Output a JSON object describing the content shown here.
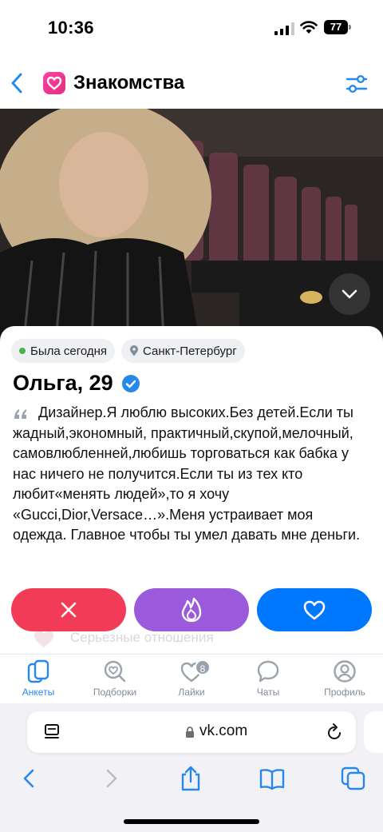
{
  "status_bar": {
    "time": "10:36",
    "battery": "77"
  },
  "header": {
    "title": "Знакомства",
    "back_icon": "chevron-left-icon",
    "filter_icon": "sliders-icon"
  },
  "profile": {
    "status_chip": "Была сегодня",
    "city_chip": "Санкт-Петербург",
    "name": "Ольга, 29",
    "verified": true,
    "bio": "Дизайнер.Я люблю высоких.Без детей.Если ты жадный,экономный, практичный,скупой,мелочный, самовлюбленней,любишь торговаться как бабка у нас ничего не получится.Если ты из тех кто любит«менять людей»,то я хочу «Gucci,Dior,Versace…».Меня устраивает моя одежда. Главное чтобы ты умел давать мне деньги.",
    "goal": "Серьезные отношения"
  },
  "actions": {
    "dislike_icon": "close-icon",
    "superlike_icon": "fire-icon",
    "like_icon": "heart-icon"
  },
  "nav": {
    "items": [
      {
        "label": "Анкеты",
        "icon": "cards-icon",
        "active": true
      },
      {
        "label": "Подборки",
        "icon": "heart-search-icon"
      },
      {
        "label": "Лайки",
        "icon": "heart-icon",
        "badge": "8"
      },
      {
        "label": "Чаты",
        "icon": "chat-bubble-icon"
      },
      {
        "label": "Профиль",
        "icon": "profile-icon"
      }
    ]
  },
  "browser": {
    "url": "vk.com"
  },
  "colors": {
    "accent": "#2688eb",
    "dislike": "#f23c57",
    "superlike": "#9b59dc",
    "like": "#0077ff",
    "online": "#4bb34b"
  }
}
